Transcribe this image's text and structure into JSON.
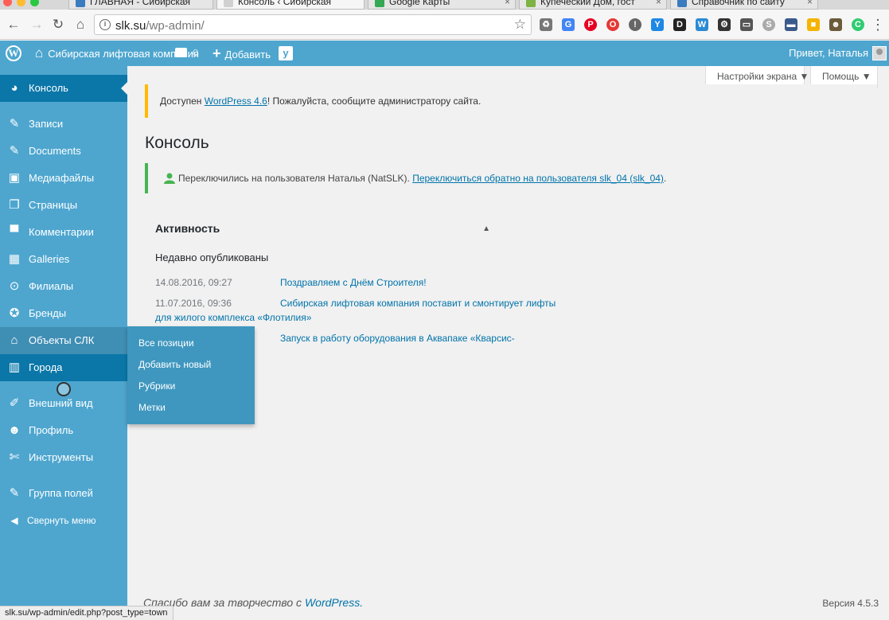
{
  "browser": {
    "tabs": [
      {
        "title": "ГЛАВНАЯ - Сибирская",
        "icon_color": "#3b7bbf"
      },
      {
        "title": "Консоль ‹ Сибирская",
        "icon_color": "#d0d0d0"
      },
      {
        "title": "Google Карты",
        "icon_color": "#34a853"
      },
      {
        "title": "Купеческий Дом, гост",
        "icon_color": "#7cb342"
      },
      {
        "title": "Справочник по сайту",
        "icon_color": "#3b7bbf"
      }
    ],
    "url_host": "slk.su",
    "url_path": "/wp-admin/",
    "status_url": "slk.su/wp-admin/edit.php?post_type=town"
  },
  "adminbar": {
    "site_name": "Сибирская лифтовая компания",
    "comments_count": "0",
    "add_label": "Добавить",
    "greeting": "Привет, Наталья"
  },
  "sidebar": {
    "items": [
      {
        "label": "Консоль",
        "icon": "dashboard-icon"
      },
      {
        "label": "Записи",
        "icon": "pin-icon"
      },
      {
        "label": "Documents",
        "icon": "pin-icon"
      },
      {
        "label": "Медиафайлы",
        "icon": "media-icon"
      },
      {
        "label": "Страницы",
        "icon": "pages-icon"
      },
      {
        "label": "Комментарии",
        "icon": "comment-icon"
      },
      {
        "label": "Galleries",
        "icon": "gallery-icon"
      },
      {
        "label": "Филиалы",
        "icon": "location-icon"
      },
      {
        "label": "Бренды",
        "icon": "award-icon"
      },
      {
        "label": "Объекты СЛК",
        "icon": "home-icon"
      },
      {
        "label": "Города",
        "icon": "building-icon"
      },
      {
        "label": "Внешний вид",
        "icon": "brush-icon"
      },
      {
        "label": "Профиль",
        "icon": "user-icon"
      },
      {
        "label": "Инструменты",
        "icon": "wrench-icon"
      },
      {
        "label": "Группа полей",
        "icon": "plugin-icon"
      },
      {
        "label": "Свернуть меню",
        "icon": "collapse-icon"
      }
    ],
    "flyout": [
      "Все позиции",
      "Добавить новый",
      "Рубрики",
      "Метки"
    ]
  },
  "screen_options": "Настройки экрана",
  "help": "Помощь",
  "notice": {
    "before": "Доступен ",
    "link": "WordPress 4.6",
    "after": "! Пожалуйста, сообщите администратору сайта."
  },
  "page_title": "Консоль",
  "switch_notice": {
    "text": "Переключились на пользователя Наталья (NatSLK). ",
    "link": "Переключиться обратно на пользователя slk_04 (slk_04)",
    "end": "."
  },
  "activity": {
    "title": "Активность",
    "subtitle": "Недавно опубликованы",
    "posts": [
      {
        "date": "14.08.2016, 09:27",
        "title": "Поздравляем с Днём Строителя!"
      },
      {
        "date": "11.07.2016, 09:36",
        "title": "Сибирская лифтовая компания поставит и смонтирует лифты",
        "title_cont": "для жилого комплекса «Флотилия»"
      },
      {
        "date": "",
        "title": "Запуск в работу оборудования в Аквапаке «Кварсис-"
      }
    ]
  },
  "footer": {
    "thanks": "Спасибо вам за творчество с ",
    "thanks_link": "WordPress.",
    "version": "Версия 4.5.3"
  }
}
